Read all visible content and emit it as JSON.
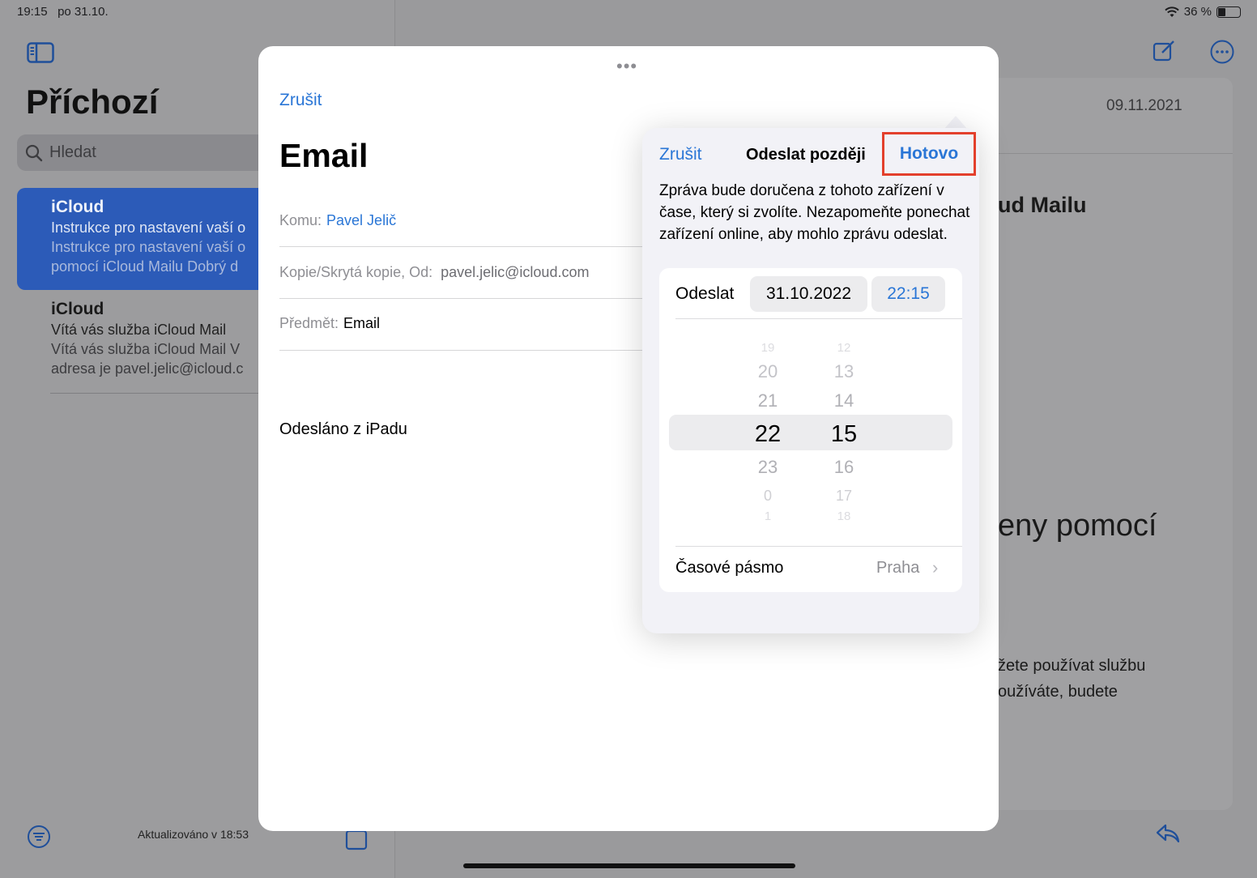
{
  "status": {
    "time": "19:15",
    "date": "po 31.10.",
    "battery": "36 %"
  },
  "sidebar": {
    "title": "Příchozí",
    "search_placeholder": "Hledat",
    "mails": [
      {
        "from": "iCloud",
        "subject": "Instrukce pro nastavení vaší o",
        "preview1": "Instrukce pro nastavení vaší o",
        "preview2": "pomocí iCloud Mailu Dobrý d"
      },
      {
        "from": "iCloud",
        "subject": "Vítá vás služba iCloud Mail",
        "preview1": "Vítá vás služba iCloud Mail V",
        "preview2": "adresa je pavel.jelic@icloud.c"
      }
    ],
    "updated": "Aktualizováno v 18:53"
  },
  "detail": {
    "date": "09.11.2021",
    "heading": "ud Mailu",
    "big_text": "eny pomocí",
    "para1": "žete používat službu",
    "para2": "oužíváte, budete"
  },
  "compose": {
    "cancel": "Zrušit",
    "title": "Email",
    "to_label": "Komu:",
    "to_value": "Pavel Jelič",
    "cc_label": "Kopie/Skrytá kopie, Od:",
    "cc_value": "pavel.jelic@icloud.com",
    "subject_label": "Předmět:",
    "subject_value": "Email",
    "signature": "Odesláno z iPadu"
  },
  "popover": {
    "cancel": "Zrušit",
    "title": "Odeslat později",
    "done": "Hotovo",
    "description": "Zpráva bude doručena z tohoto zařízení v čase, který si zvolíte. Nezapomeňte ponechat zařízení online, aby mohlo zprávu odeslat.",
    "send_label": "Odeslat",
    "date": "31.10.2022",
    "time": "22:15",
    "hours": [
      "19",
      "20",
      "21",
      "22",
      "23",
      "0",
      "1"
    ],
    "minutes": [
      "12",
      "13",
      "14",
      "15",
      "16",
      "17",
      "18"
    ],
    "timezone_label": "Časové pásmo",
    "timezone_value": "Praha"
  },
  "colors": {
    "accent": "#2a76d6",
    "highlight_box": "#e3402c"
  }
}
